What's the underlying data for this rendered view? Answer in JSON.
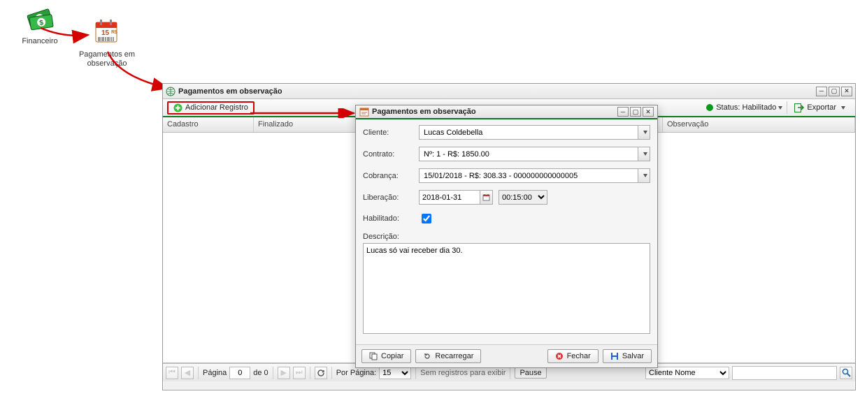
{
  "desktop": {
    "financeiro_label": "Financeiro",
    "pagobs_label": "Pagamentos em observação"
  },
  "main_window": {
    "title": "Pagamentos em observação",
    "add_button_label": "Adicionar Registro",
    "status_label": "Status: Habilitado",
    "export_label": "Exportar",
    "columns": {
      "cadastro": "Cadastro",
      "finalizado": "Finalizado",
      "observacao": "Observação"
    },
    "pager": {
      "page_label_prefix": "Página",
      "page_value": "0",
      "page_of": "de 0",
      "per_page_label": "Por Página:",
      "per_page_value": "15",
      "empty_text": "Sem registros para exibir",
      "pause_label": "Pause",
      "search_field_value": "Cliente Nome",
      "search_text": ""
    }
  },
  "dialog": {
    "title": "Pagamentos em observação",
    "labels": {
      "cliente": "Cliente:",
      "contrato": "Contrato:",
      "cobranca": "Cobrança:",
      "liberacao": "Liberação:",
      "habilitado": "Habilitado:",
      "descricao": "Descrição:"
    },
    "values": {
      "cliente": "Lucas Coldebella",
      "contrato": "Nº: 1 - R$: 1850.00",
      "cobranca": "15/01/2018 - R$: 308.33 - 000000000000005",
      "liberacao_date": "2018-01-31",
      "liberacao_time": "00:15:00",
      "habilitado_checked": true,
      "descricao": "Lucas só vai receber dia 30."
    },
    "footer": {
      "copiar": "Copiar",
      "recarregar": "Recarregar",
      "fechar": "Fechar",
      "salvar": "Salvar"
    }
  }
}
